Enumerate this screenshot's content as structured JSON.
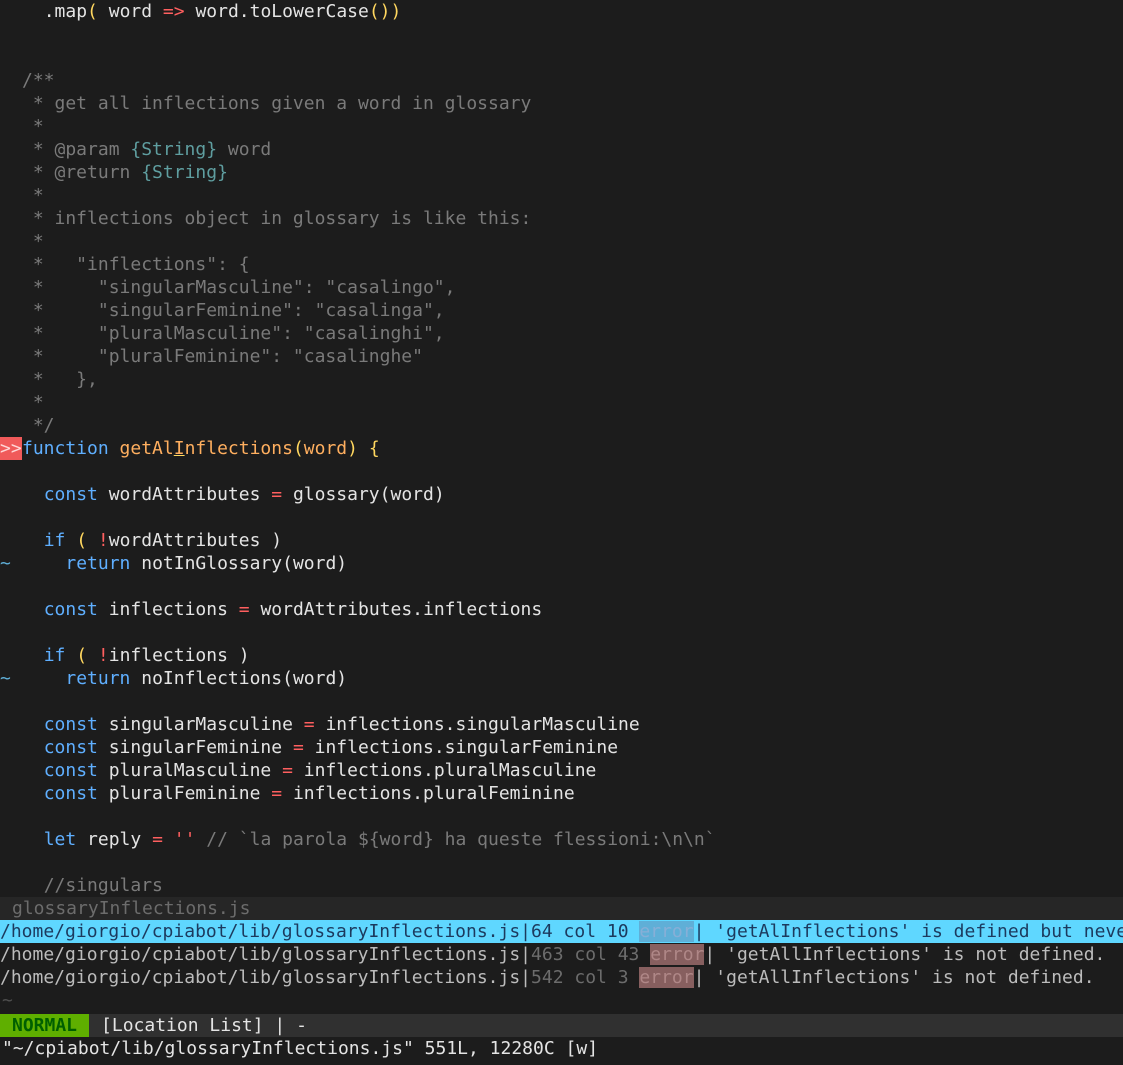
{
  "editor": {
    "sign_marker": ">>",
    "tilde": "~",
    "code": {
      "l01": ".map( word => word.toLowerCase())",
      "l02": "",
      "l03": "",
      "l04": "/**",
      "l05": " * get all inflections given a word in glossary",
      "l06": " *",
      "l07a": " * @param ",
      "l07b": "{String}",
      "l07c": " word",
      "l08a": " * @return ",
      "l08b": "{String}",
      "l09": " *",
      "l10": " * inflections object in glossary is like this:",
      "l11": " *",
      "l12": " *   \"inflections\": {",
      "l13": " *     \"singularMasculine\": \"casalingo\",",
      "l14": " *     \"singularFeminine\": \"casalinga\",",
      "l15": " *     \"pluralMasculine\": \"casalinghi\",",
      "l16": " *     \"pluralFeminine\": \"casalinghe\"",
      "l17": " *   },",
      "l18": " *",
      "l19": " */",
      "fn_kw": "function",
      "fn_name_a": "getAl",
      "fn_name_b": "I",
      "fn_name_c": "nflections",
      "fn_param": "word",
      "l21": "",
      "l22_kw": "const",
      "l22_rest": " wordAttributes ",
      "l22_eq": "=",
      "l22_tail": " glossary(word)",
      "l24_kw": "if",
      "l24_rest": " ( ",
      "l24_not": "!",
      "l24_tail": "wordAttributes )",
      "l25_kw": "return",
      "l25_tail": " notInGlossary(word)",
      "l27_kw": "const",
      "l27_rest": " inflections ",
      "l27_eq": "=",
      "l27_tail": " wordAttributes.inflections",
      "l29_kw": "if",
      "l29_rest": " ( ",
      "l29_not": "!",
      "l29_tail": "inflections )",
      "l30_kw": "return",
      "l30_tail": " noInflections(word)",
      "l32_kw": "const",
      "l32_rest": " singularMasculine ",
      "l32_tail": " inflections.singularMasculine",
      "l33_rest": " singularFeminine ",
      "l33_tail": " inflections.singularFeminine",
      "l34_rest": " pluralMasculine ",
      "l34_tail": " inflections.pluralMasculine",
      "l35_rest": " pluralFeminine ",
      "l35_tail": " inflections.pluralFeminine",
      "l37_kw": "let",
      "l37_rest": " reply ",
      "l37_eq": "=",
      "l37_str": " ''",
      "l37_comment": " // `la parola ${word} ha queste flessioni:\\n\\n`",
      "l39": "//singulars"
    }
  },
  "window_status": {
    "filename": "glossaryInflections.js"
  },
  "location_list": {
    "rows": [
      {
        "path": "/home/giorgio/cpiabot/lib/glossaryInflections.js",
        "pos": "64 col 10",
        "type": "error",
        "msg": " 'getAlInflections' is defined but never used.",
        "selected": true
      },
      {
        "path": "/home/giorgio/cpiabot/lib/glossaryInflections.js",
        "pos": "463 col 43",
        "type": "error",
        "msg": " 'getAllInflections' is not defined.",
        "selected": false
      },
      {
        "path": "/home/giorgio/cpiabot/lib/glossaryInflections.js",
        "pos": "542 col 3",
        "type": "error",
        "msg": " 'getAllInflections' is not defined.",
        "selected": false
      }
    ],
    "empty_marker": "~"
  },
  "statusline": {
    "mode": "NORMAL",
    "title": "[Location List] | -"
  },
  "cmdline": {
    "text": "\"~/cpiabot/lib/glossaryInflections.js\" 551L, 12280C [w]"
  },
  "colors": {
    "background": "#1c1c1c",
    "keyword": "#5fafff",
    "function_name": "#ffaf5f",
    "operator": "#ff5f5f",
    "comment": "#7a7a7a",
    "selected_row": "#5fd7ff",
    "mode_normal": "#5faf00",
    "sign": "#f05a5a"
  }
}
